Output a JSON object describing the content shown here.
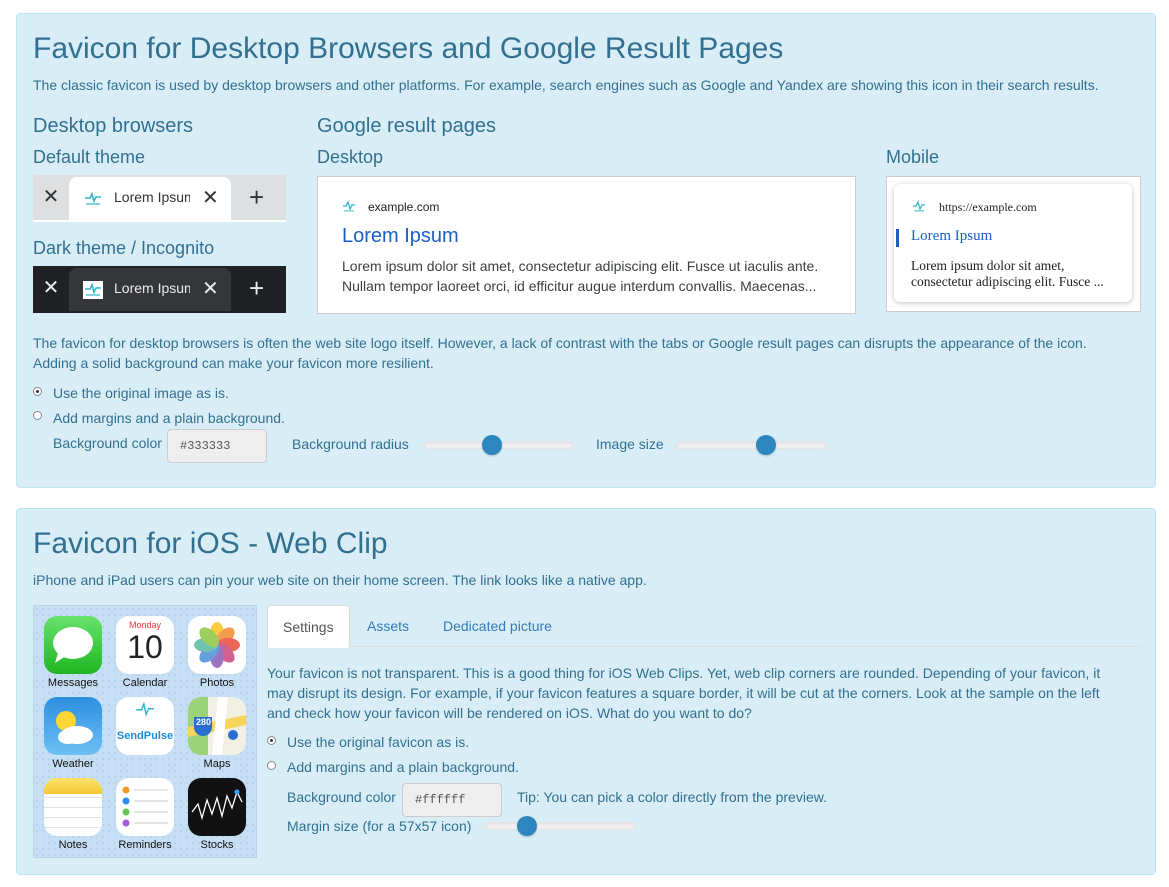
{
  "section1": {
    "title": "Favicon for Desktop Browsers and Google Result Pages",
    "description": "The classic favicon is used by desktop browsers and other platforms. For example, search engines such as Google and Yandex are showing this icon in their search results.",
    "desktop_heading": "Desktop browsers",
    "default_theme_label": "Default theme",
    "dark_theme_label": "Dark theme / Incognito",
    "tab_title": "Lorem Ipsum",
    "close_glyph": "✕",
    "plus_glyph": "+",
    "google_heading": "Google result pages",
    "google_desktop_label": "Desktop",
    "google_mobile_label": "Mobile",
    "google_desktop": {
      "site": "example.com",
      "title": "Lorem Ipsum",
      "line1": "Lorem ipsum dolor sit amet, consectetur adipiscing elit. Fusce ut iaculis ante.",
      "line2": "Nullam tempor laoreet orci, id efficitur augue interdum convallis. Maecenas..."
    },
    "google_mobile": {
      "site": "https://example.com",
      "title": "Lorem Ipsum",
      "line1": "Lorem ipsum dolor sit amet,",
      "line2": "consectetur adipiscing elit. Fusce ..."
    },
    "note_line1": "The favicon for desktop browsers is often the web site logo itself. However, a lack of contrast with the tabs or Google result pages can disrupts the appearance of the icon.",
    "note_line2": "Adding a solid background can make your favicon more resilient.",
    "option_original": "Use the original image as is.",
    "option_margins": "Add margins and a plain background.",
    "selected_option": "original",
    "background_color_label": "Background color",
    "background_color_value": "#333333",
    "background_radius_label": "Background radius",
    "background_radius_value": 0.45,
    "image_size_label": "Image size",
    "image_size_value": 0.6
  },
  "section2": {
    "title": "Favicon for iOS - Web Clip",
    "description": "iPhone and iPad users can pin your web site on their home screen. The link looks like a native app.",
    "apps": [
      {
        "name": "Messages",
        "icon": "messages-icon"
      },
      {
        "name": "Calendar",
        "icon": "calendar-icon",
        "day": "Monday",
        "date": "10"
      },
      {
        "name": "Photos",
        "icon": "photos-icon"
      },
      {
        "name": "Weather",
        "icon": "weather-icon"
      },
      {
        "name": "",
        "icon": "sendpulse-icon",
        "label": "SendPulse"
      },
      {
        "name": "Maps",
        "icon": "maps-icon",
        "badge": "280"
      },
      {
        "name": "Notes",
        "icon": "notes-icon"
      },
      {
        "name": "Reminders",
        "icon": "reminders-icon"
      },
      {
        "name": "Stocks",
        "icon": "stocks-icon"
      }
    ],
    "tabs": [
      "Settings",
      "Assets",
      "Dedicated picture"
    ],
    "active_tab": "Settings",
    "paragraph_line1": "Your favicon is not transparent. This is a good thing for iOS Web Clips. Yet, web clip corners are rounded. Depending of your favicon, it",
    "paragraph_line2": "may disrupt its design. For example, if your favicon features a square border, it will be cut at the corners. Look at the sample on the left",
    "paragraph_line3": "and check how your favicon will be rendered on iOS. What do you want to do?",
    "option_original": "Use the original favicon as is.",
    "option_margins": "Add margins and a plain background.",
    "selected_option": "original",
    "background_color_label": "Background color",
    "background_color_value": "#ffffff",
    "tip": "Tip: You can pick a color directly from the preview.",
    "margin_size_label": "Margin size (for a 57x57 icon)",
    "margin_size_value": 0.27
  },
  "colors": {
    "panel_bg": "#d9edf7",
    "text": "#31708f",
    "link": "#337ab7",
    "slider_knob": "#2e86c1",
    "google_link": "#1a5fc8",
    "favicon_teal": "#2fb5c8"
  }
}
